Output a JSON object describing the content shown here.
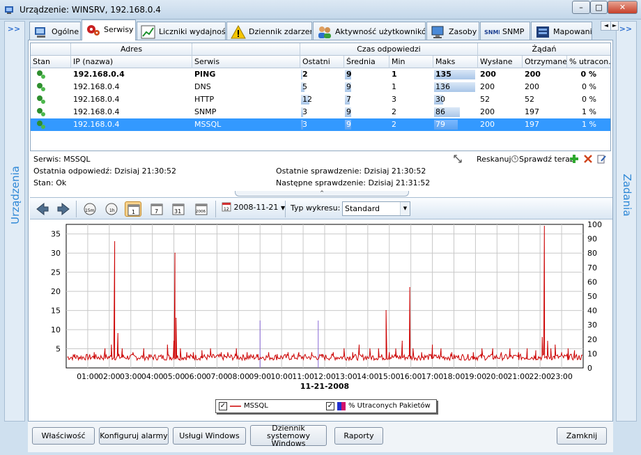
{
  "window": {
    "title": "Urządzenie: WINSRV, 192.168.0.4",
    "minimize": "–",
    "maximize": "□",
    "close": "✕"
  },
  "nav": {
    "left_arrow": ">>",
    "right_arrow": ">>",
    "left_label": "Urządzenia",
    "right_label": "Zadania"
  },
  "tabs": [
    {
      "label": "Ogólne",
      "icon": "computer-icon"
    },
    {
      "label": "Serwisy",
      "icon": "gears-icon"
    },
    {
      "label": "Liczniki wydajności",
      "icon": "chart-icon"
    },
    {
      "label": "Dziennik zdarzeń",
      "icon": "warning-icon"
    },
    {
      "label": "Aktywność użytkowników",
      "icon": "users-icon"
    },
    {
      "label": "Zasoby",
      "icon": "monitor-icon"
    },
    {
      "label": "SNMP",
      "icon": "snmp-icon",
      "icon_text": "SNMP"
    },
    {
      "label": "Mapowani",
      "icon": "network-icon"
    }
  ],
  "tab_scroll": {
    "left": "◄",
    "right": "►"
  },
  "table": {
    "groups": [
      "Adres",
      "Czas odpowiedzi",
      "Żądań"
    ],
    "columns": [
      "Stan",
      "IP (nazwa)",
      "Serwis",
      "Ostatni",
      "Średnia",
      "Min",
      "Maks",
      "Wysłane",
      "Otrzymane",
      "% utracon..."
    ],
    "rows": [
      {
        "ip": "192.168.0.4",
        "service": "PING",
        "last": "2",
        "avg": "9",
        "min": "1",
        "max": "135",
        "sent": "200",
        "recv": "200",
        "lost": "0 %",
        "maxv": 135,
        "avgv": 9,
        "lastv": 2
      },
      {
        "ip": "192.168.0.4",
        "service": "DNS",
        "last": "5",
        "avg": "9",
        "min": "1",
        "max": "136",
        "sent": "200",
        "recv": "200",
        "lost": "0 %",
        "maxv": 136,
        "avgv": 9,
        "lastv": 5
      },
      {
        "ip": "192.168.0.4",
        "service": "HTTP",
        "last": "12",
        "avg": "7",
        "min": "3",
        "max": "30",
        "sent": "52",
        "recv": "52",
        "lost": "0 %",
        "maxv": 30,
        "avgv": 7,
        "lastv": 12
      },
      {
        "ip": "192.168.0.4",
        "service": "SNMP",
        "last": "3",
        "avg": "9",
        "min": "2",
        "max": "86",
        "sent": "200",
        "recv": "197",
        "lost": "1 %",
        "maxv": 86,
        "avgv": 9,
        "lastv": 3
      },
      {
        "ip": "192.168.0.4",
        "service": "MSSQL",
        "last": "3",
        "avg": "9",
        "min": "2",
        "max": "79",
        "sent": "200",
        "recv": "197",
        "lost": "1 %",
        "maxv": 79,
        "avgv": 9,
        "lastv": 3
      }
    ]
  },
  "details": {
    "service": "Serwis: MSSQL",
    "last_response": "Ostatnia odpowiedź: Dzisiaj 21:30:52",
    "state": "Stan: Ok",
    "last_check": "Ostatnie sprawdzenie: Dzisiaj 21:30:52",
    "next_check": "Następne sprawdzenie: Dzisiaj 21:31:52"
  },
  "actions": {
    "rescan": "Reskanuj",
    "check_now": "Sprawdź teraz"
  },
  "chart_toolbar": {
    "date": "2008-11-21",
    "chart_type_label": "Typ wykresu:",
    "chart_type_value": "Standard",
    "btn_15m": "15m",
    "btn_1h": "1h",
    "btn_day": "1",
    "btn_week": "7",
    "btn_month": "31",
    "btn_year": "2006",
    "date_icon_text": "12"
  },
  "chart_data": {
    "type": "line",
    "xlabel": "11-21-2008",
    "x_ticks": [
      "01:00",
      "02:00",
      "03:00",
      "04:00",
      "05:00",
      "06:00",
      "07:00",
      "08:00",
      "09:00",
      "10:00",
      "11:00",
      "12:00",
      "13:00",
      "14:00",
      "15:00",
      "16:00",
      "17:00",
      "18:00",
      "19:00",
      "20:00",
      "21:00",
      "22:00",
      "23:00"
    ],
    "xlim": [
      0,
      24
    ],
    "y_left_ticks": [
      5,
      10,
      15,
      20,
      25,
      30,
      35
    ],
    "ylim_left": [
      0,
      37.5
    ],
    "y_right_ticks": [
      0,
      10,
      20,
      30,
      40,
      50,
      60,
      70,
      80,
      90,
      100
    ],
    "ylim_right": [
      0,
      100
    ],
    "grid": true,
    "legend_position": "bottom-center",
    "series": [
      {
        "name": "MSSQL",
        "color": "#cc0000",
        "axis": "left",
        "baseline": 2,
        "x": [
          0.4,
          1.3,
          1.8,
          2.1,
          2.25,
          2.4,
          2.6,
          3.1,
          3.6,
          4.35,
          4.7,
          5.0,
          5.05,
          5.1,
          5.3,
          5.6,
          5.9,
          6.3,
          6.7,
          7.2,
          7.5,
          7.9,
          8.4,
          8.9,
          9.4,
          9.8,
          10.3,
          10.8,
          11.4,
          11.9,
          12.4,
          12.9,
          13.3,
          13.6,
          14.1,
          14.5,
          14.85,
          15.0,
          15.3,
          15.6,
          15.95,
          16.1,
          16.5,
          17.0,
          17.4,
          17.9,
          18.4,
          18.9,
          19.3,
          19.8,
          20.2,
          20.6,
          21.0,
          21.4,
          21.8,
          22.1,
          22.2,
          22.35,
          22.5,
          22.7,
          23.0,
          23.3,
          23.6
        ],
        "y": [
          3.5,
          4,
          5,
          6,
          33,
          9,
          5,
          4,
          5,
          3,
          6,
          7,
          30,
          13,
          5,
          4,
          4,
          4.5,
          5,
          4,
          4,
          5,
          4,
          3.5,
          4,
          3.5,
          4,
          4,
          4,
          3.5,
          4,
          5,
          4,
          6,
          5,
          5,
          15,
          4,
          5,
          7,
          21,
          5,
          4,
          6,
          5,
          4,
          3.5,
          4,
          5,
          5,
          4,
          5,
          4,
          5,
          4.5,
          8,
          37,
          7,
          5,
          6,
          4,
          5,
          4.5
        ]
      },
      {
        "name": "% Utraconych Pakietów",
        "color": "#0000cc",
        "axis": "right",
        "x": [
          9.0,
          11.7
        ],
        "y": [
          33,
          33
        ]
      }
    ]
  },
  "legend": {
    "mssql": "MSSQL",
    "loss": "% Utraconych Pakietów",
    "check": "✓"
  },
  "buttons": {
    "properties": "Właściwość",
    "alarms": "Konfiguruj alarmy",
    "services": "Usługi Windows",
    "eventlog_line1": "Dziennik systemowy",
    "eventlog_line2": "Windows",
    "reports": "Raporty",
    "close": "Zamknij"
  }
}
